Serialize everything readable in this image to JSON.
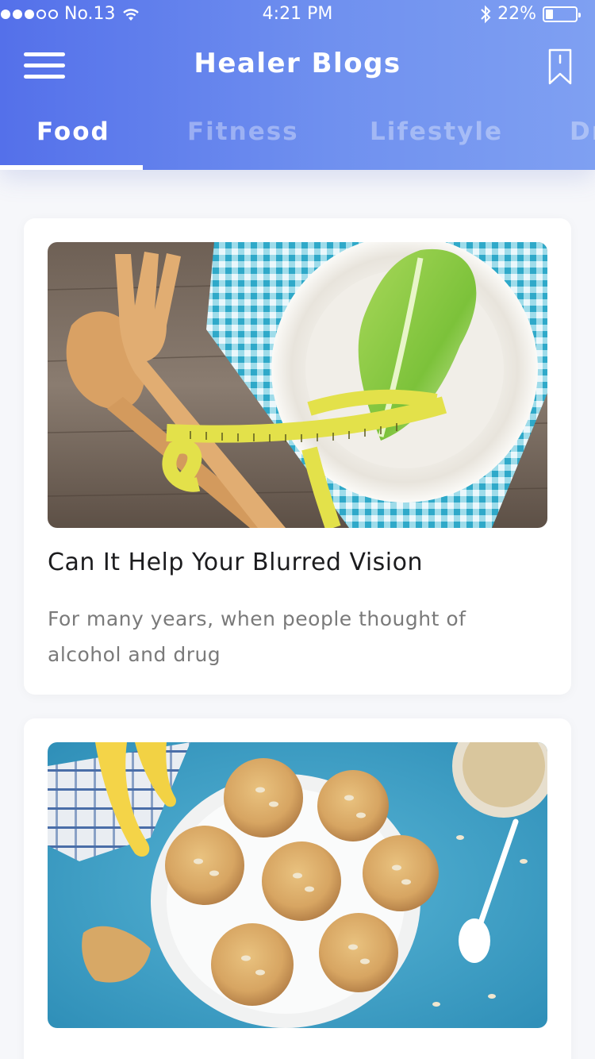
{
  "status_bar": {
    "carrier": "No.13",
    "time": "4:21 PM",
    "battery": "22%",
    "signal_filled": 3,
    "signal_total": 5,
    "battery_level": 0.22
  },
  "header": {
    "title": "Healer Blogs",
    "menu_icon": "hamburger-menu-icon",
    "bookmark_icon": "bookmark-icon"
  },
  "tabs": [
    {
      "label": "Food",
      "active": true
    },
    {
      "label": "Fitness",
      "active": false
    },
    {
      "label": "Lifestyle",
      "active": false
    },
    {
      "label": "Dr",
      "active": false
    }
  ],
  "posts": [
    {
      "image": "salad-plate-measuring-tape-photo",
      "title": "Can It Help Your Blurred Vision",
      "excerpt": "For many years, when people thought of alcohol and drug"
    },
    {
      "image": "oat-muffins-bananas-photo",
      "title": "",
      "excerpt": ""
    }
  ],
  "colors": {
    "header_gradient_start": "#5470ea",
    "header_gradient_end": "#7fa0f2",
    "background": "#f6f7fa",
    "card": "#ffffff",
    "title_text": "#1c1c1e",
    "excerpt_text": "#7a7a7a"
  }
}
